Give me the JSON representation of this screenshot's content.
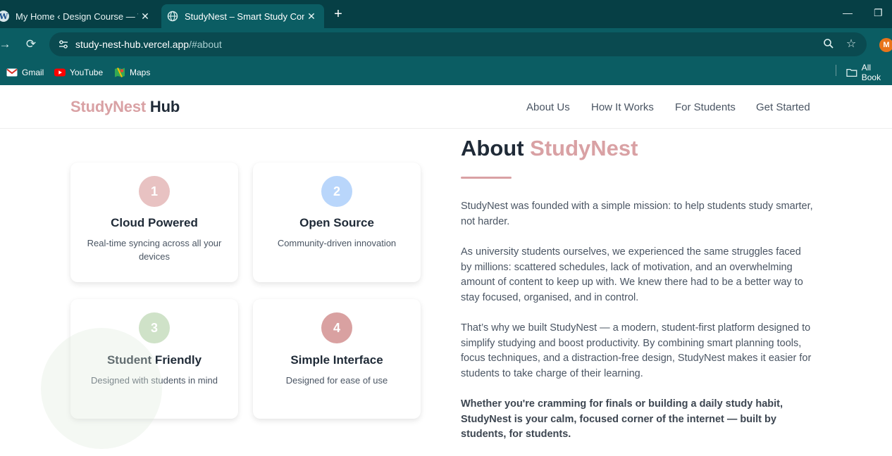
{
  "browser": {
    "tabs": [
      {
        "title": "My Home ‹ Design Course — W",
        "active": false
      },
      {
        "title": "StudyNest – Smart Study Comp",
        "active": true
      }
    ],
    "new_tab_symbol": "+",
    "url_host": "study-nest-hub.vercel.app",
    "url_path": "/#about",
    "profile_initial": "M",
    "bookmarks": [
      {
        "label": "Gmail",
        "icon": "gmail-icon"
      },
      {
        "label": "YouTube",
        "icon": "youtube-icon"
      },
      {
        "label": "Maps",
        "icon": "maps-icon"
      }
    ],
    "all_bookmarks_label": "All Book"
  },
  "site": {
    "brand_part1": "StudyNest",
    "brand_part2": "Hub",
    "nav": [
      "About Us",
      "How It Works",
      "For Students",
      "Get Started"
    ],
    "features": [
      {
        "number": "1",
        "title": "Cloud Powered",
        "description": "Real-time syncing across all your devices",
        "color": "#e8c2c2"
      },
      {
        "number": "2",
        "title": "Open Source",
        "description": "Community-driven innovation",
        "color": "#b9d6fb"
      },
      {
        "number": "3",
        "title": "Student Friendly",
        "description": "Designed with students in mind",
        "color": "#cfe2c8"
      },
      {
        "number": "4",
        "title": "Simple Interface",
        "description": "Designed for ease of use",
        "color": "#d9a1a1"
      }
    ],
    "about": {
      "heading": "About",
      "heading_accent": "StudyNest",
      "paragraphs": [
        "StudyNest was founded with a simple mission: to help students study smarter, not harder.",
        "As university students ourselves, we experienced the same struggles faced by millions: scattered schedules, lack of motivation, and an overwhelming amount of content to keep up with. We knew there had to be a better way to stay focused, organised, and in control.",
        "That’s why we built StudyNest — a modern, student-first platform designed to simplify studying and boost productivity. By combining smart planning tools, focus techniques, and a distraction-free design, StudyNest makes it easier for students to take charge of their learning."
      ],
      "closing": "Whether you're cramming for finals or building a daily study habit, StudyNest is your calm, focused corner of the internet — built by students, for students."
    }
  },
  "colors": {
    "chrome_dark": "#063f45",
    "chrome": "#0b5d63",
    "accent": "#d9a1a4",
    "heading": "#1f2a37",
    "body_text": "#4a5563"
  }
}
